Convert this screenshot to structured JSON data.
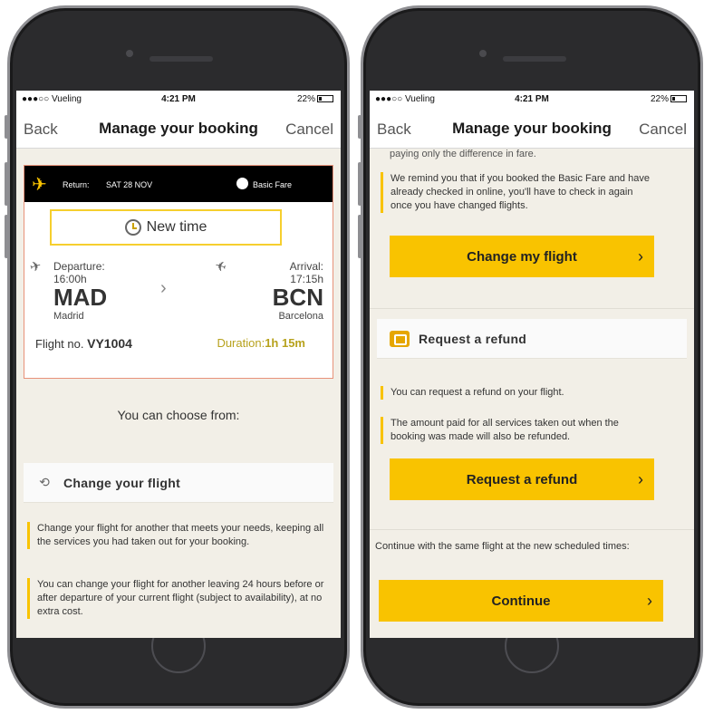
{
  "status_bar": {
    "carrier": "●●●○○ Vueling",
    "time": "4:21 PM",
    "battery": "22%"
  },
  "nav": {
    "back": "Back",
    "title": "Manage your booking",
    "cancel": "Cancel"
  },
  "left_screen": {
    "card": {
      "return_label": "Return:",
      "return_date": "SAT 28 NOV",
      "fare": "Basic Fare",
      "new_time": "New time",
      "departure_label": "Departure:",
      "departure_time": "16:00h",
      "departure_code": "MAD",
      "departure_city": "Madrid",
      "arrival_label": "Arrival:",
      "arrival_time": "17:15h",
      "arrival_code": "BCN",
      "arrival_city": "Barcelona",
      "flight_no_label": "Flight no.",
      "flight_no": "VY1004",
      "duration_label": "Duration:",
      "duration": "1h 15m"
    },
    "choose_text": "You can choose from:",
    "change_section_title": "Change your flight",
    "change_bullets": [
      "Change your flight for another that meets your needs, keeping all the services you had taken out for your booking.",
      "You can change your flight for another leaving 24 hours before or after departure of your current flight (subject to availability), at no extra cost."
    ]
  },
  "right_screen": {
    "top_partial": "paying only the difference in fare.",
    "remind_bullet": "We remind you that if you booked the Basic Fare and have already checked in online, you'll have to check in again once you have changed flights.",
    "change_button": "Change my flight",
    "refund_section_title": "Request a refund",
    "refund_bullets": [
      "You can request a refund on your flight.",
      "The amount paid for all services taken out when the booking was made will also be refunded."
    ],
    "refund_button": "Request a refund",
    "continue_text": "Continue with the same flight at the new scheduled times:",
    "continue_button": "Continue"
  },
  "colors": {
    "accent": "#f9c300",
    "card_border": "#e8927a",
    "header_bg": "#000000",
    "screen_bg": "#f2efe7"
  },
  "icons": {
    "plane": "plane-icon",
    "clock": "clock-icon",
    "takeoff": "takeoff-icon",
    "landing": "landing-icon",
    "swap": "swap-icon",
    "refund": "refund-icon",
    "chevron": "chevron-right-icon"
  }
}
